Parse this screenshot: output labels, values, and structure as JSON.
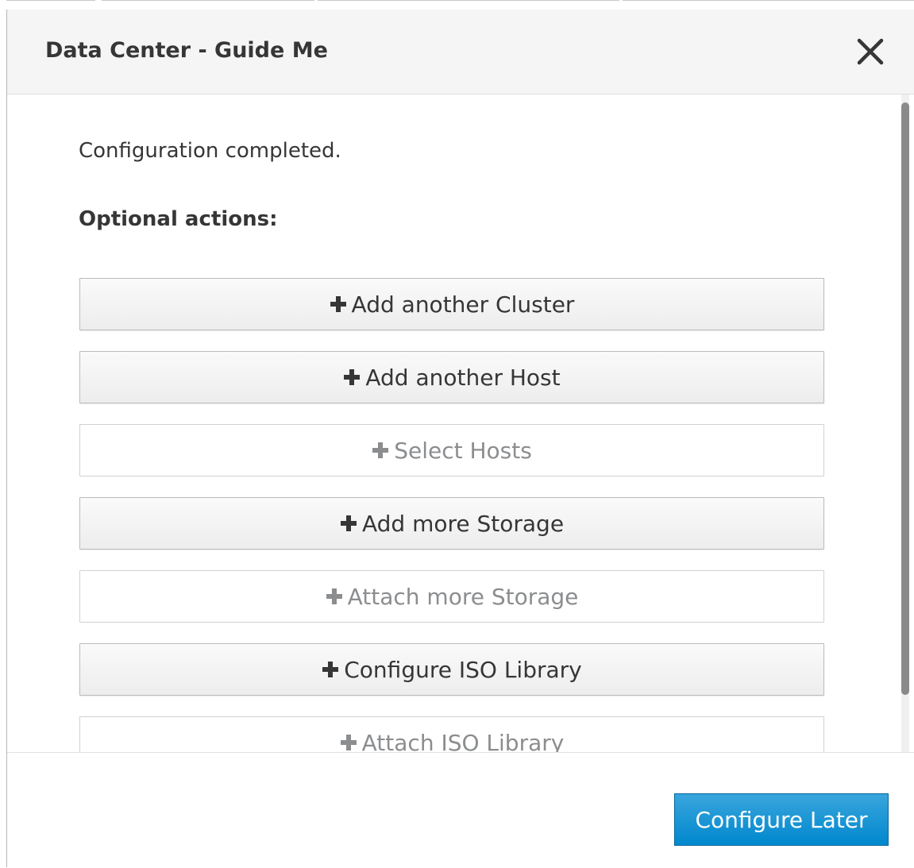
{
  "modal": {
    "title": "Data Center - Guide Me",
    "close_icon": "close-icon"
  },
  "body": {
    "status": "Configuration completed.",
    "optional_heading": "Optional actions:",
    "actions": [
      {
        "label": "Add another Cluster",
        "enabled": true,
        "icon": "plus-icon"
      },
      {
        "label": "Add another Host",
        "enabled": true,
        "icon": "plus-icon"
      },
      {
        "label": "Select Hosts",
        "enabled": false,
        "icon": "plus-icon"
      },
      {
        "label": "Add more Storage",
        "enabled": true,
        "icon": "plus-icon"
      },
      {
        "label": "Attach more Storage",
        "enabled": false,
        "icon": "plus-icon"
      },
      {
        "label": "Configure ISO Library",
        "enabled": true,
        "icon": "plus-icon"
      },
      {
        "label": "Attach ISO Library",
        "enabled": false,
        "icon": "plus-icon"
      }
    ]
  },
  "footer": {
    "configure_later_label": "Configure Later"
  },
  "colors": {
    "primary": "#0088ce",
    "header_bg": "#f5f5f5",
    "text": "#363636",
    "disabled_text": "#8b8d8f"
  }
}
